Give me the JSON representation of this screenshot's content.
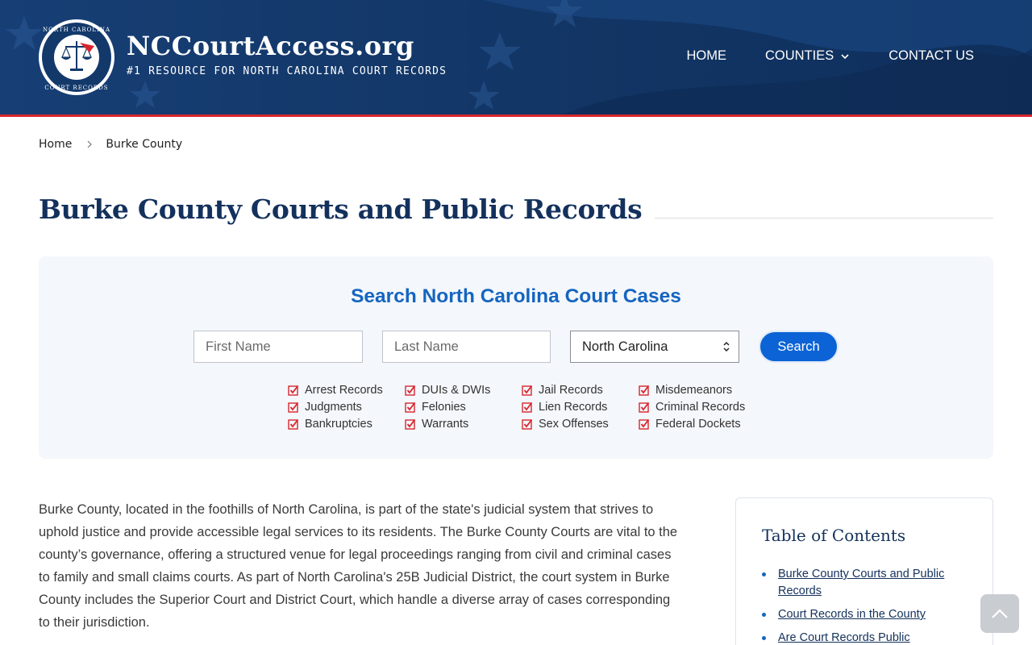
{
  "colors": {
    "header_bg": "#13396b",
    "header_accent": "#d9262e",
    "primary_blue": "#1565c0",
    "button_blue": "#0b63d6",
    "title_navy": "#13315c",
    "panel_bg": "#f4f7fb"
  },
  "header": {
    "brand": {
      "title": "NCCourtAccess.org",
      "subtitle": "#1 RESOURCE FOR NORTH CAROLINA COURT RECORDS",
      "seal_top_text": "NORTH CAROLINA",
      "seal_bottom_text": "COURT RECORDS",
      "seal_icon": "scales-of-justice-icon"
    },
    "nav": {
      "home": "HOME",
      "counties": "COUNTIES",
      "contact": "CONTACT US"
    }
  },
  "breadcrumb": {
    "home": "Home",
    "current": "Burke County"
  },
  "page": {
    "title": "Burke County Courts and Public Records"
  },
  "search": {
    "heading": "Search North Carolina Court Cases",
    "first_name_placeholder": "First Name",
    "last_name_placeholder": "Last Name",
    "state_value": "North Carolina",
    "button_label": "Search",
    "record_types": [
      "Arrest Records",
      "DUIs & DWIs",
      "Jail Records",
      "Misdemeanors",
      "Judgments",
      "Felonies",
      "Lien Records",
      "Criminal Records",
      "Bankruptcies",
      "Warrants",
      "Sex Offenses",
      "Federal Dockets"
    ]
  },
  "content": {
    "intro": "Burke County, located in the foothills of North Carolina, is part of the state's judicial system that strives to uphold justice and provide accessible legal services to its residents. The Burke County Courts are vital to the county’s governance, offering a structured venue for legal proceedings ranging from civil and criminal cases to family and small claims courts. As part of North Carolina's 25B Judicial District, the court system in Burke County includes the Superior Court and District Court, which handle a diverse array of cases corresponding to their jurisdiction."
  },
  "toc": {
    "title": "Table of Contents",
    "items": [
      "Burke County Courts and Public Records",
      "Court Records in the County",
      "Are Court Records Public"
    ]
  }
}
